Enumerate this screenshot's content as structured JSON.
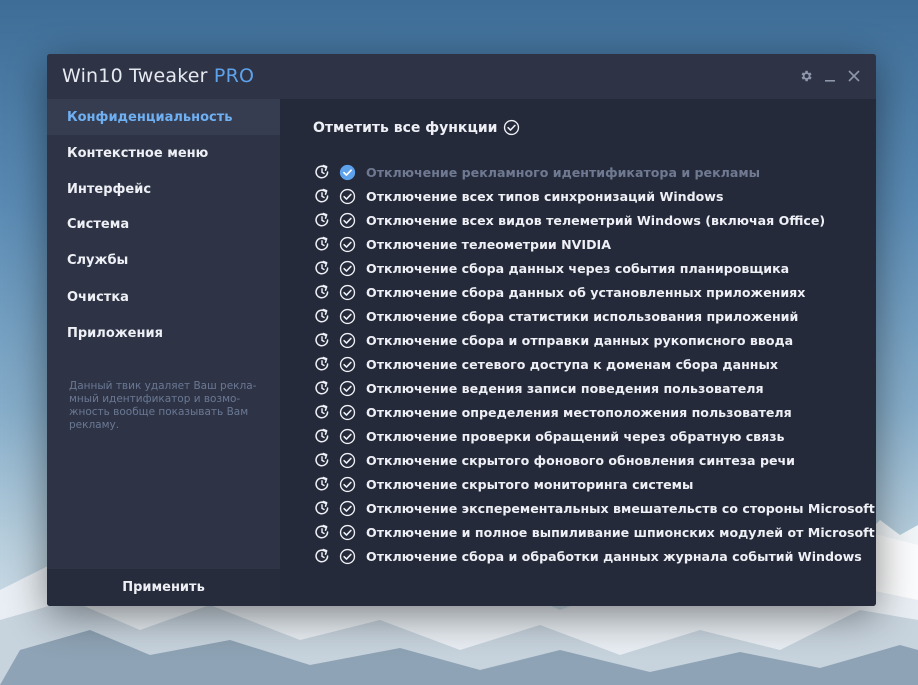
{
  "window": {
    "title_main": "Win10 Tweaker ",
    "title_accent": "PRO"
  },
  "colors": {
    "accent": "#5ea2ec",
    "window_bg": "#252a3a",
    "sidebar_bg": "#2e3446",
    "text": "#eef0f5",
    "muted": "#6f7a92"
  },
  "icons": {
    "settings": "gear-icon",
    "minimize": "minimize-icon",
    "close": "close-icon",
    "reset": "reset-icon",
    "check": "check-circle-icon"
  },
  "sidebar": {
    "items": [
      {
        "label": "Конфиденциальность",
        "active": true
      },
      {
        "label": "Контекстное меню",
        "active": false
      },
      {
        "label": "Интерфейс",
        "active": false
      },
      {
        "label": "Система",
        "active": false
      },
      {
        "label": "Службы",
        "active": false
      },
      {
        "label": "Очистка",
        "active": false
      },
      {
        "label": "Приложения",
        "active": false
      }
    ],
    "description": "Данный твик удаляет Ваш рекла-мный идентификатор и возмо-жность вообще показывать Вам рекламу.",
    "apply_label": "Применить"
  },
  "main": {
    "select_all_label": "Отметить все функции",
    "features": [
      {
        "label": "Отключение рекламного идентификатора и рекламы",
        "checked": true
      },
      {
        "label": "Отключение всех типов синхронизаций Windows",
        "checked": false
      },
      {
        "label": "Отключение всех видов телеметрий Windows (включая Office)",
        "checked": false
      },
      {
        "label": "Отключение телеометрии NVIDIA",
        "checked": false
      },
      {
        "label": "Отключение сбора данных через события планировщика",
        "checked": false
      },
      {
        "label": "Отключение сбора данных об установленных приложениях",
        "checked": false
      },
      {
        "label": "Отключение сбора статистики использования приложений",
        "checked": false
      },
      {
        "label": "Отключение сбора и отправки данных рукописного ввода",
        "checked": false
      },
      {
        "label": "Отключение сетевого доступа к доменам сбора данных",
        "checked": false
      },
      {
        "label": "Отключение ведения записи поведения пользователя",
        "checked": false
      },
      {
        "label": "Отключение определения местоположения пользователя",
        "checked": false
      },
      {
        "label": "Отключение проверки обращений через обратную связь",
        "checked": false
      },
      {
        "label": "Отключение скрытого фонового обновления синтеза речи",
        "checked": false
      },
      {
        "label": "Отключение скрытого мониторинга системы",
        "checked": false
      },
      {
        "label": "Отключение эксперементальных вмешательств со стороны Microsoft",
        "checked": false
      },
      {
        "label": "Отключение и полное выпиливание шпионских модулей от Microsoft",
        "checked": false
      },
      {
        "label": "Отключение сбора и обработки данных журнала событий Windows",
        "checked": false
      }
    ]
  }
}
